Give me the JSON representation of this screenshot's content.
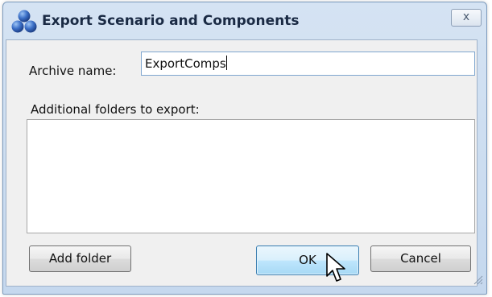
{
  "window": {
    "title": "Export Scenario and Components",
    "close_label": "x",
    "app_icon": "three-spheres-logo-icon"
  },
  "form": {
    "archive_label": "Archive name:",
    "archive_value": "ExportComps",
    "folders_label": "Additional folders to export:",
    "folders": []
  },
  "buttons": {
    "add_folder": "Add folder",
    "ok": "OK",
    "cancel": "Cancel"
  },
  "colors": {
    "title_bar": "#c9daef",
    "accent_blue": "#3b6fc7",
    "ok_button_highlight": "#bee6fd"
  }
}
